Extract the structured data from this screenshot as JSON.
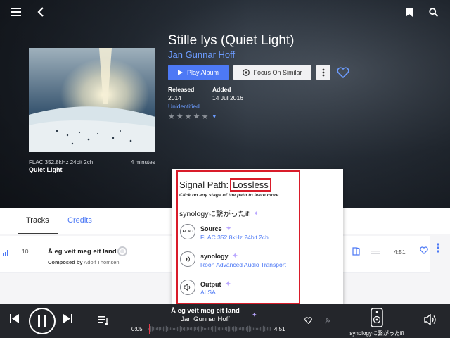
{
  "header": {
    "menu_icon": "hamburger-icon",
    "back_icon": "arrow-left-icon",
    "bookmark_icon": "bookmark-icon",
    "search_icon": "search-icon"
  },
  "album": {
    "title": "Stille lys (Quiet Light)",
    "artist": "Jan Gunnar Hoff",
    "play_label": "Play Album",
    "focus_label": "Focus On Similar",
    "released_label": "Released",
    "released_value": "2014",
    "added_label": "Added",
    "added_value": "14 Jul 2016",
    "identification": "Unidentified",
    "rating_stars": 5,
    "rating_filled": 0
  },
  "now_playing_card": {
    "format": "FLAC 352.8kHz 24bit 2ch",
    "duration": "4 minutes",
    "track": "Quiet Light"
  },
  "tabs": [
    {
      "label": "Tracks",
      "active": true
    },
    {
      "label": "Credits",
      "active": false
    }
  ],
  "track_row": {
    "number": "10",
    "title": "Å eg veit meg eit land",
    "composed_prefix": "Composed by",
    "composer": "Adolf Thomsen",
    "duration": "4:51"
  },
  "signal_path": {
    "title": "Signal Path:",
    "quality": "Lossless",
    "hint": "Click on any stage of the path to learn more",
    "zone": "synologyに繋がったifi",
    "stages": [
      {
        "icon": "flac-icon",
        "icon_text": "FLAC",
        "name": "Source",
        "detail": "FLAC 352.8kHz 24bit 2ch"
      },
      {
        "icon": "speaker-cone-icon",
        "icon_text": "",
        "name": "synology",
        "detail": "Roon Advanced Audio Transport"
      },
      {
        "icon": "speaker-volume-icon",
        "icon_text": "",
        "name": "Output",
        "detail": "ALSA"
      }
    ]
  },
  "player": {
    "title": "Å eg veit meg eit land",
    "artist": "Jan Gunnar Hoff",
    "elapsed": "0:05",
    "total": "4:51",
    "progress": 0.017,
    "zone_name": "synologyに繋がったifi"
  },
  "colors": {
    "accent": "#4d79f5",
    "highlight_frame": "#d91c2a",
    "player_bg": "#24262b"
  }
}
